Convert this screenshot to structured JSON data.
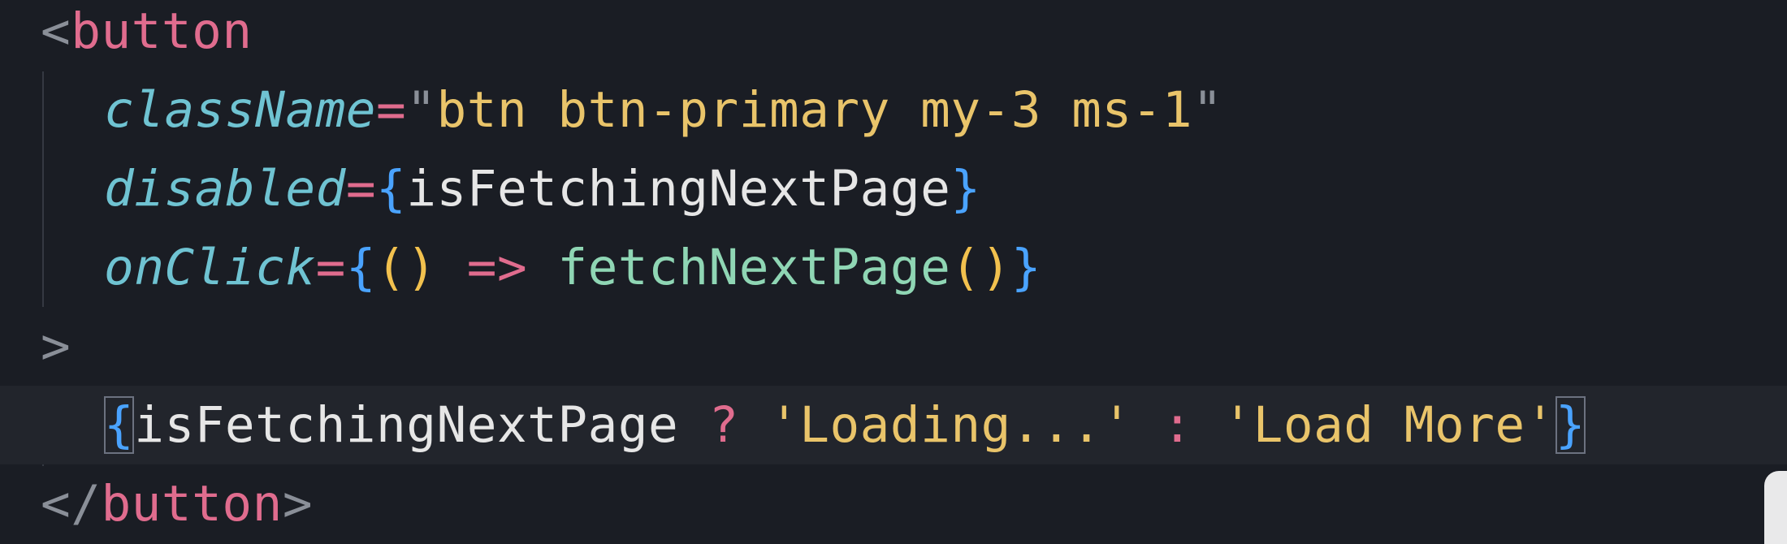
{
  "editor": {
    "lines": [
      {
        "open": "<",
        "tag": "button"
      },
      {
        "attr": "className",
        "eq": "=",
        "q1": "\"",
        "value": "btn btn-primary my-3 ms-1",
        "q2": "\""
      },
      {
        "attr": "disabled",
        "eq": "=",
        "lbrace": "{",
        "ident": "isFetchingNextPage",
        "rbrace": "}"
      },
      {
        "attr": "onClick",
        "eq": "=",
        "lbrace": "{",
        "parens": "()",
        "arrow": "=>",
        "fn": "fetchNextPage",
        "call": "()",
        "rbrace": "}"
      },
      {
        "close": ">"
      },
      {
        "lbrace": "{",
        "ident": "isFetchingNextPage",
        "q": "?",
        "s1": "'Loading...'",
        "colon": ":",
        "s2": "'Load More'",
        "rbrace": "}"
      },
      {
        "open": "</",
        "tag": "button",
        "close": ">"
      }
    ]
  },
  "colors": {
    "background": "#1a1d24",
    "tag": "#e06c8e",
    "attribute": "#6fc3d2",
    "string": "#e9c46a",
    "brace": "#4aa3ff",
    "function": "#8fd6b4"
  }
}
